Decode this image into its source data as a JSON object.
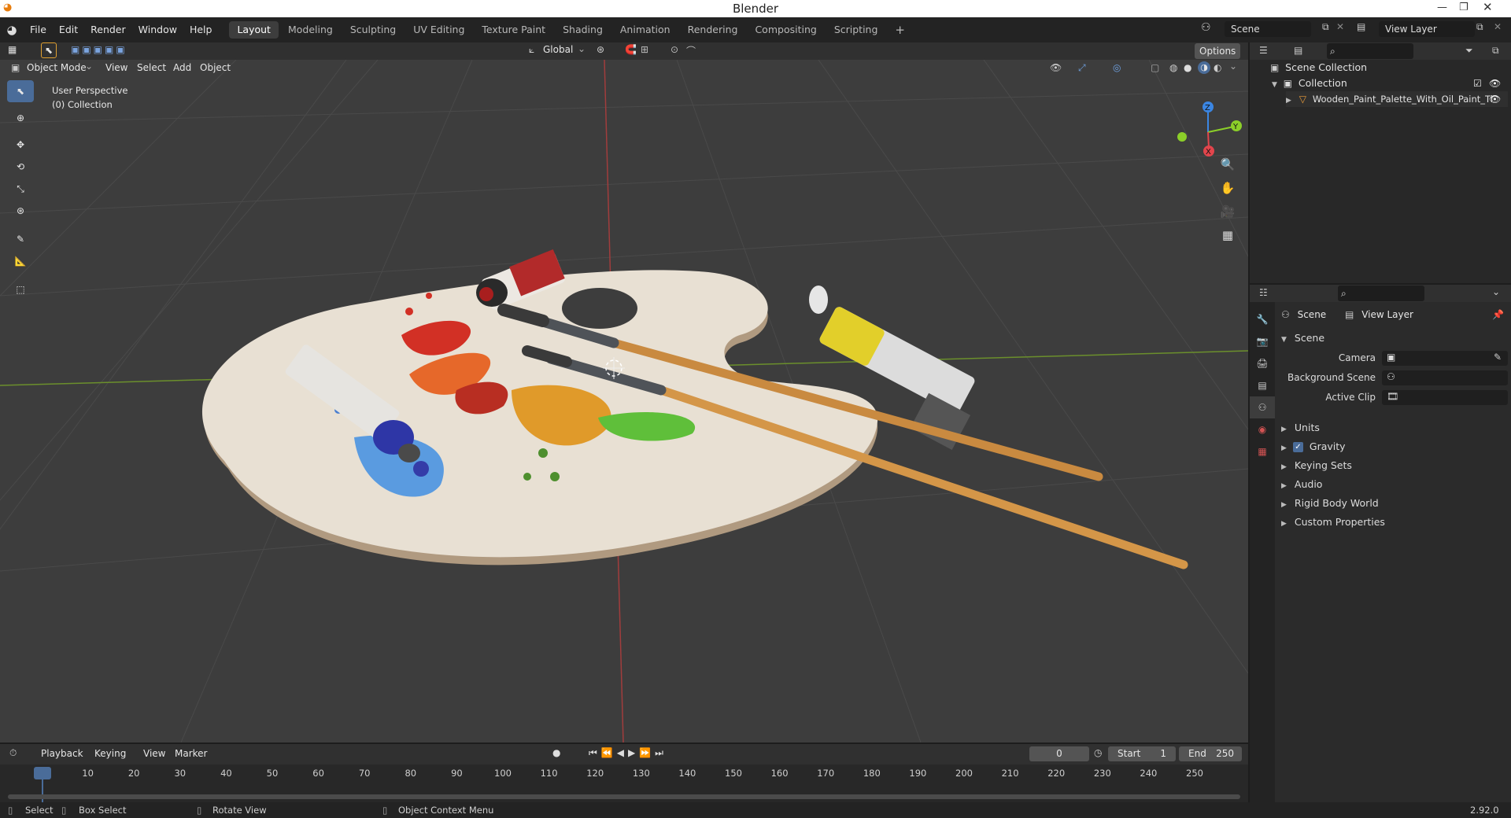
{
  "window": {
    "title": "Blender"
  },
  "menus": [
    "File",
    "Edit",
    "Render",
    "Window",
    "Help"
  ],
  "workspaces": [
    "Layout",
    "Modeling",
    "Sculpting",
    "UV Editing",
    "Texture Paint",
    "Shading",
    "Animation",
    "Rendering",
    "Compositing",
    "Scripting"
  ],
  "active_workspace": "Layout",
  "scene_field": "Scene",
  "view_layer_field": "View Layer",
  "toolbar": {
    "transform_orientation": "Global",
    "options_label": "Options"
  },
  "viewport_header": {
    "mode": "Object Mode",
    "menu": [
      "View",
      "Select",
      "Add",
      "Object"
    ]
  },
  "viewport": {
    "perspective_label": "User Perspective",
    "collection_label": "(0) Collection",
    "gizmo": {
      "z": "Z",
      "y": "Y",
      "x": "X"
    }
  },
  "outliner": {
    "scene_collection": "Scene Collection",
    "collection": "Collection",
    "object": "Wooden_Paint_Palette_With_Oil_Paint_Ti"
  },
  "properties": {
    "breadcrumb_scene": "Scene",
    "breadcrumb_view_layer": "View Layer",
    "section": "Scene",
    "fields": [
      {
        "label": "Camera"
      },
      {
        "label": "Background Scene"
      },
      {
        "label": "Active Clip"
      }
    ],
    "panels": [
      "Units",
      "Gravity",
      "Keying Sets",
      "Audio",
      "Rigid Body World",
      "Custom Properties"
    ],
    "gravity_checked": true
  },
  "timeline": {
    "menu": [
      "Playback",
      "Keying",
      "View",
      "Marker"
    ],
    "current_frame": "0",
    "start_label": "Start",
    "start": "1",
    "end_label": "End",
    "end": "250",
    "ticks": [
      "0",
      "10",
      "20",
      "30",
      "40",
      "50",
      "60",
      "70",
      "80",
      "90",
      "100",
      "110",
      "120",
      "130",
      "140",
      "150",
      "160",
      "170",
      "180",
      "190",
      "200",
      "210",
      "220",
      "230",
      "240",
      "250"
    ]
  },
  "status_bar": {
    "select": "Select",
    "box_select": "Box Select",
    "rotate_view": "Rotate View",
    "context_menu": "Object Context Menu",
    "version": "2.92.0"
  },
  "colors": {
    "accent": "#4a6c99",
    "axis_x": "#e2454c",
    "axis_y": "#8ccf29",
    "axis_z": "#3b86e3"
  }
}
